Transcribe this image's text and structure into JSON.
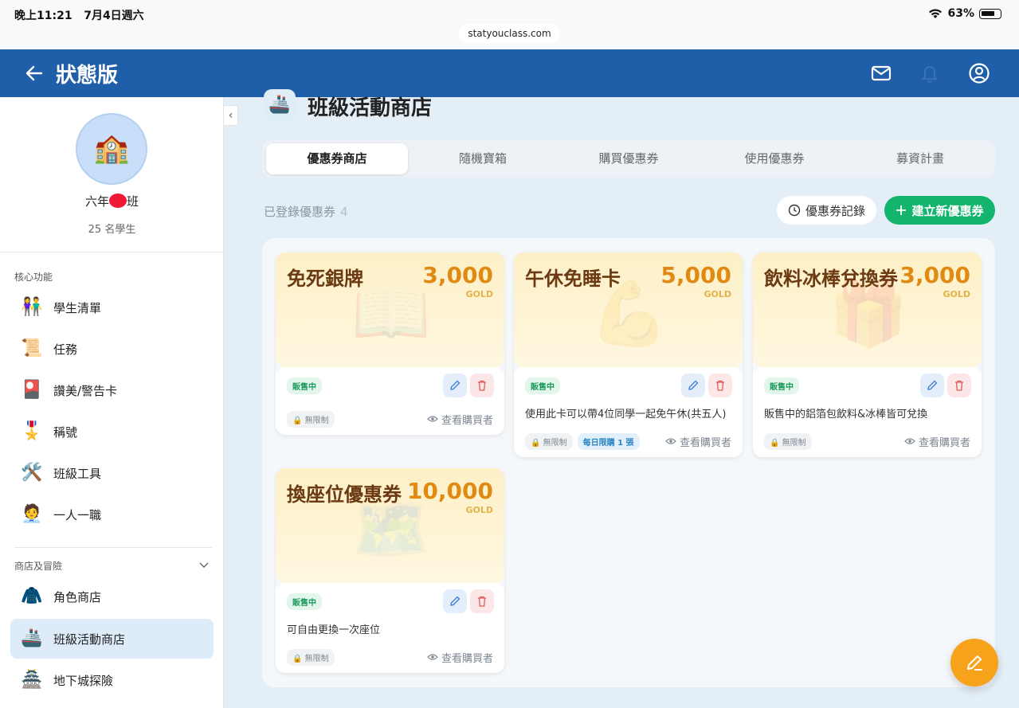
{
  "status_bar": {
    "time": "晚上11:21",
    "date": "7月4日週六",
    "battery": "63%",
    "url": "statyouclass.com"
  },
  "header": {
    "title": "狀態版",
    "icons": [
      "back-arrow-icon",
      "mail-icon",
      "bell-icon",
      "user-account-icon"
    ]
  },
  "sidebar": {
    "class_name_prefix": "六年",
    "class_name_suffix": "班",
    "student_count": "25 名學生",
    "section_core": "核心功能",
    "core_items": [
      {
        "label": "學生清單",
        "icon": "👫"
      },
      {
        "label": "任務",
        "icon": "📜"
      },
      {
        "label": "讚美/警告卡",
        "icon": "🎴"
      },
      {
        "label": "稱號",
        "icon": "🎖️"
      },
      {
        "label": "班級工具",
        "icon": "🛠️"
      },
      {
        "label": "一人一職",
        "icon": "🧑‍💼"
      }
    ],
    "section_shop": "商店及冒險",
    "shop_items": [
      {
        "label": "角色商店",
        "icon": "🧥"
      },
      {
        "label": "班級活動商店",
        "icon": "🚢"
      },
      {
        "label": "地下城探險",
        "icon": "🏯"
      }
    ]
  },
  "main": {
    "title": "班級活動商店",
    "tabs": [
      "優惠券商店",
      "隨機寶箱",
      "購買優惠券",
      "使用優惠券",
      "募資計畫"
    ],
    "registered_label": "已登錄優惠券",
    "registered_count": "4",
    "history_button": "優惠券記錄",
    "create_button": "建立新優惠券",
    "coupons": [
      {
        "name": "免死銀牌",
        "price": "3,000",
        "unit": "GOLD",
        "status": "販售中",
        "description": "",
        "limit": "無限制",
        "daily_limit": "",
        "view_buyers": "查看購買者",
        "watermark": "📖"
      },
      {
        "name": "午休免睡卡",
        "price": "5,000",
        "unit": "GOLD",
        "status": "販售中",
        "description": "使用此卡可以帶4位同學一起免午休(共五人)",
        "limit": "無限制",
        "daily_limit": "每日限購 1 張",
        "view_buyers": "查看購買者",
        "watermark": "💪"
      },
      {
        "name": "飲料冰棒兌換券",
        "price": "3,000",
        "unit": "GOLD",
        "status": "販售中",
        "description": "販售中的鋁箔包飲料&冰棒皆可兌換",
        "limit": "無限制",
        "daily_limit": "",
        "view_buyers": "查看購買者",
        "watermark": "🎁"
      },
      {
        "name": "換座位優惠券",
        "price": "10,000",
        "unit": "GOLD",
        "status": "販售中",
        "description": "可自由更換一次座位",
        "limit": "無限制",
        "daily_limit": "",
        "view_buyers": "查看購買者",
        "watermark": "🗺️"
      }
    ]
  },
  "colors": {
    "header_blue": "#1f5ea8",
    "create_green": "#13b46d",
    "fab_orange": "#f7a21b",
    "price_orange": "#e08a14"
  }
}
